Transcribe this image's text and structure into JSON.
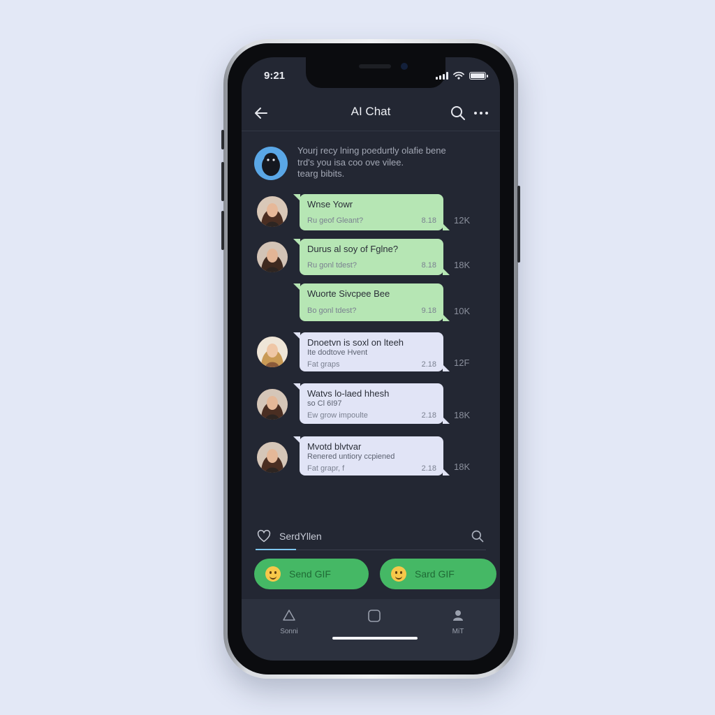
{
  "status_bar": {
    "time": "9:21"
  },
  "header": {
    "title": "AI Chat"
  },
  "bot_intro": {
    "lines": [
      "Yourj recy lning poedurtly olafie bene",
      "trd's you isa coo ove vilee.",
      "tearg bibits."
    ]
  },
  "messages": [
    {
      "style": "green",
      "title": "Wnse Yowr",
      "subtitle": "",
      "footer_left": "Ru geof Gleant?",
      "time": "8.18",
      "count": "12K",
      "has_avatar": true
    },
    {
      "style": "green",
      "title": "Durus al soy of Fglne?",
      "subtitle": "",
      "footer_left": "Ru gonl tdest?",
      "time": "8.18",
      "count": "18K",
      "has_avatar": true
    },
    {
      "style": "green",
      "title": "Wuorte Sivcpee Bee",
      "subtitle": "",
      "footer_left": "Bo gonl tdest?",
      "time": "9.18",
      "count": "10K",
      "has_avatar": false
    },
    {
      "style": "light",
      "title": "Dnoetvn is soxl on lteeh",
      "subtitle": "Ite dodtove Hvent",
      "footer_left": "Fat graps",
      "time": "2.18",
      "count": "12F",
      "has_avatar": true
    },
    {
      "style": "light",
      "title": "Watvs lo-laed hhesh",
      "subtitle": "so Cl 6I97",
      "footer_left": "Ew grow impoulte",
      "time": "2.18",
      "count": "18K",
      "has_avatar": true
    },
    {
      "style": "light",
      "title": "Mvotd blvtvar",
      "subtitle": "Renered untiory ccpiened",
      "footer_left": "Fat grapr, f",
      "time": "2.18",
      "count": "18K",
      "has_avatar": true
    }
  ],
  "composer": {
    "placeholder": "SerdYllen"
  },
  "quick_actions": [
    {
      "label": "Send GIF"
    },
    {
      "label": "Sard GIF"
    }
  ],
  "share_icons": [
    "camera-icon",
    "twitter-icon",
    "image-icon",
    "home-icon"
  ],
  "tabbar": {
    "tabs": [
      {
        "label": "Sonni",
        "icon": "triangle-icon"
      },
      {
        "label": "",
        "icon": "square-icon"
      },
      {
        "label": "MiT",
        "icon": "person-icon"
      }
    ]
  },
  "colors": {
    "accent_green": "#45b865",
    "bubble_green": "#b6e6b4",
    "bubble_light": "#e1e4f6",
    "screen_bg": "#232733"
  }
}
